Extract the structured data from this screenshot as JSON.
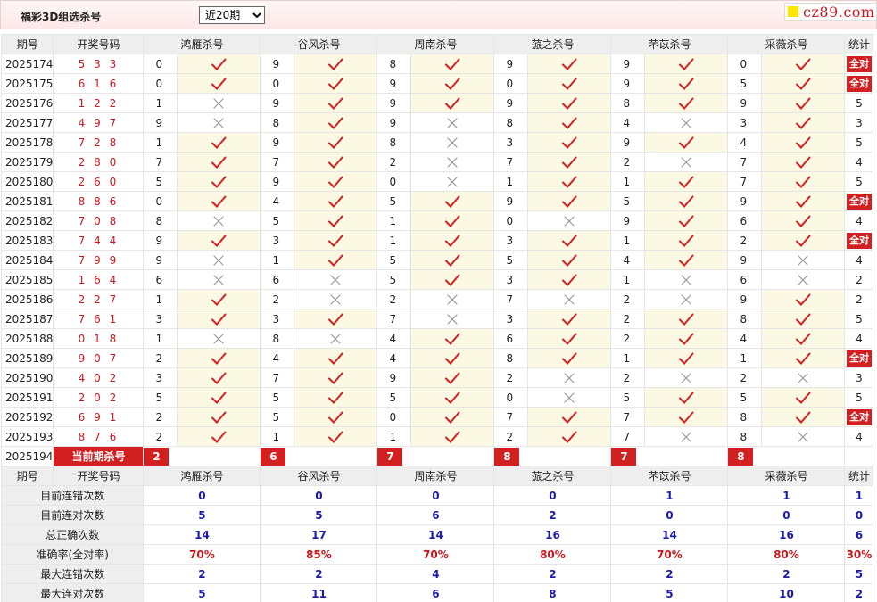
{
  "header": {
    "title": "福彩3D组选杀号",
    "period_select": {
      "value": "近20期",
      "options": [
        "近20期"
      ]
    },
    "logo_text": "cz89.com"
  },
  "columns": {
    "period": "期号",
    "numbers": "开奖号码",
    "experts": [
      "鸿雁杀号",
      "谷风杀号",
      "周南杀号",
      "蒎之杀号",
      "芣苡杀号",
      "采薇杀号"
    ],
    "stats": "统计"
  },
  "rows": [
    {
      "period": "2025174",
      "numbers": "5 3 3",
      "kills": [
        {
          "n": "0",
          "ok": true
        },
        {
          "n": "9",
          "ok": true
        },
        {
          "n": "8",
          "ok": true
        },
        {
          "n": "9",
          "ok": true
        },
        {
          "n": "9",
          "ok": true
        },
        {
          "n": "0",
          "ok": true
        }
      ],
      "stat": "全对"
    },
    {
      "period": "2025175",
      "numbers": "6 1 6",
      "kills": [
        {
          "n": "0",
          "ok": true
        },
        {
          "n": "0",
          "ok": true
        },
        {
          "n": "9",
          "ok": true
        },
        {
          "n": "0",
          "ok": true
        },
        {
          "n": "9",
          "ok": true
        },
        {
          "n": "5",
          "ok": true
        }
      ],
      "stat": "全对"
    },
    {
      "period": "2025176",
      "numbers": "1 2 2",
      "kills": [
        {
          "n": "1",
          "ok": false
        },
        {
          "n": "9",
          "ok": true
        },
        {
          "n": "9",
          "ok": true
        },
        {
          "n": "9",
          "ok": true
        },
        {
          "n": "8",
          "ok": true
        },
        {
          "n": "9",
          "ok": true
        }
      ],
      "stat": "5"
    },
    {
      "period": "2025177",
      "numbers": "4 9 7",
      "kills": [
        {
          "n": "9",
          "ok": false
        },
        {
          "n": "8",
          "ok": true
        },
        {
          "n": "9",
          "ok": false
        },
        {
          "n": "8",
          "ok": true
        },
        {
          "n": "4",
          "ok": false
        },
        {
          "n": "3",
          "ok": true
        }
      ],
      "stat": "3"
    },
    {
      "period": "2025178",
      "numbers": "7 2 8",
      "kills": [
        {
          "n": "1",
          "ok": true
        },
        {
          "n": "9",
          "ok": true
        },
        {
          "n": "8",
          "ok": false
        },
        {
          "n": "3",
          "ok": true
        },
        {
          "n": "9",
          "ok": true
        },
        {
          "n": "4",
          "ok": true
        }
      ],
      "stat": "5"
    },
    {
      "period": "2025179",
      "numbers": "2 8 0",
      "kills": [
        {
          "n": "7",
          "ok": true
        },
        {
          "n": "7",
          "ok": true
        },
        {
          "n": "2",
          "ok": false
        },
        {
          "n": "7",
          "ok": true
        },
        {
          "n": "2",
          "ok": false
        },
        {
          "n": "7",
          "ok": true
        }
      ],
      "stat": "4"
    },
    {
      "period": "2025180",
      "numbers": "2 6 0",
      "kills": [
        {
          "n": "5",
          "ok": true
        },
        {
          "n": "9",
          "ok": true
        },
        {
          "n": "0",
          "ok": false
        },
        {
          "n": "1",
          "ok": true
        },
        {
          "n": "1",
          "ok": true
        },
        {
          "n": "7",
          "ok": true
        }
      ],
      "stat": "5"
    },
    {
      "period": "2025181",
      "numbers": "8 8 6",
      "kills": [
        {
          "n": "0",
          "ok": true
        },
        {
          "n": "4",
          "ok": true
        },
        {
          "n": "5",
          "ok": true
        },
        {
          "n": "9",
          "ok": true
        },
        {
          "n": "5",
          "ok": true
        },
        {
          "n": "9",
          "ok": true
        }
      ],
      "stat": "全对"
    },
    {
      "period": "2025182",
      "numbers": "7 0 8",
      "kills": [
        {
          "n": "8",
          "ok": false
        },
        {
          "n": "5",
          "ok": true
        },
        {
          "n": "1",
          "ok": true
        },
        {
          "n": "0",
          "ok": false
        },
        {
          "n": "9",
          "ok": true
        },
        {
          "n": "6",
          "ok": true
        }
      ],
      "stat": "4"
    },
    {
      "period": "2025183",
      "numbers": "7 4 4",
      "kills": [
        {
          "n": "9",
          "ok": true
        },
        {
          "n": "3",
          "ok": true
        },
        {
          "n": "1",
          "ok": true
        },
        {
          "n": "3",
          "ok": true
        },
        {
          "n": "1",
          "ok": true
        },
        {
          "n": "2",
          "ok": true
        }
      ],
      "stat": "全对"
    },
    {
      "period": "2025184",
      "numbers": "7 9 9",
      "kills": [
        {
          "n": "9",
          "ok": false
        },
        {
          "n": "1",
          "ok": true
        },
        {
          "n": "5",
          "ok": true
        },
        {
          "n": "5",
          "ok": true
        },
        {
          "n": "4",
          "ok": true
        },
        {
          "n": "9",
          "ok": false
        }
      ],
      "stat": "4"
    },
    {
      "period": "2025185",
      "numbers": "1 6 4",
      "kills": [
        {
          "n": "6",
          "ok": false
        },
        {
          "n": "6",
          "ok": false
        },
        {
          "n": "5",
          "ok": true
        },
        {
          "n": "3",
          "ok": true
        },
        {
          "n": "1",
          "ok": false
        },
        {
          "n": "6",
          "ok": false
        }
      ],
      "stat": "2"
    },
    {
      "period": "2025186",
      "numbers": "2 2 7",
      "kills": [
        {
          "n": "1",
          "ok": true
        },
        {
          "n": "2",
          "ok": false
        },
        {
          "n": "2",
          "ok": false
        },
        {
          "n": "7",
          "ok": false
        },
        {
          "n": "2",
          "ok": false
        },
        {
          "n": "9",
          "ok": true
        }
      ],
      "stat": "2"
    },
    {
      "period": "2025187",
      "numbers": "7 6 1",
      "kills": [
        {
          "n": "3",
          "ok": true
        },
        {
          "n": "3",
          "ok": true
        },
        {
          "n": "7",
          "ok": false
        },
        {
          "n": "3",
          "ok": true
        },
        {
          "n": "2",
          "ok": true
        },
        {
          "n": "8",
          "ok": true
        }
      ],
      "stat": "5"
    },
    {
      "period": "2025188",
      "numbers": "0 1 8",
      "kills": [
        {
          "n": "1",
          "ok": false
        },
        {
          "n": "8",
          "ok": false
        },
        {
          "n": "4",
          "ok": true
        },
        {
          "n": "6",
          "ok": true
        },
        {
          "n": "2",
          "ok": true
        },
        {
          "n": "4",
          "ok": true
        }
      ],
      "stat": "4"
    },
    {
      "period": "2025189",
      "numbers": "9 0 7",
      "kills": [
        {
          "n": "2",
          "ok": true
        },
        {
          "n": "4",
          "ok": true
        },
        {
          "n": "4",
          "ok": true
        },
        {
          "n": "8",
          "ok": true
        },
        {
          "n": "1",
          "ok": true
        },
        {
          "n": "1",
          "ok": true
        }
      ],
      "stat": "全对"
    },
    {
      "period": "2025190",
      "numbers": "4 0 2",
      "kills": [
        {
          "n": "3",
          "ok": true
        },
        {
          "n": "7",
          "ok": true
        },
        {
          "n": "9",
          "ok": true
        },
        {
          "n": "2",
          "ok": false
        },
        {
          "n": "2",
          "ok": false
        },
        {
          "n": "2",
          "ok": false
        }
      ],
      "stat": "3"
    },
    {
      "period": "2025191",
      "numbers": "2 0 2",
      "kills": [
        {
          "n": "5",
          "ok": true
        },
        {
          "n": "5",
          "ok": true
        },
        {
          "n": "5",
          "ok": true
        },
        {
          "n": "0",
          "ok": false
        },
        {
          "n": "5",
          "ok": true
        },
        {
          "n": "5",
          "ok": true
        }
      ],
      "stat": "5"
    },
    {
      "period": "2025192",
      "numbers": "6 9 1",
      "kills": [
        {
          "n": "2",
          "ok": true
        },
        {
          "n": "5",
          "ok": true
        },
        {
          "n": "0",
          "ok": true
        },
        {
          "n": "7",
          "ok": true
        },
        {
          "n": "7",
          "ok": true
        },
        {
          "n": "8",
          "ok": true
        }
      ],
      "stat": "全对"
    },
    {
      "period": "2025193",
      "numbers": "8 7 6",
      "kills": [
        {
          "n": "2",
          "ok": true
        },
        {
          "n": "1",
          "ok": true
        },
        {
          "n": "1",
          "ok": true
        },
        {
          "n": "2",
          "ok": true
        },
        {
          "n": "7",
          "ok": false
        },
        {
          "n": "8",
          "ok": false
        }
      ],
      "stat": "4"
    }
  ],
  "current": {
    "period": "2025194",
    "label": "当前期杀号",
    "kills": [
      "2",
      "6",
      "7",
      "8",
      "7",
      "8"
    ]
  },
  "summary": [
    {
      "label": "目前连错次数",
      "values": [
        "0",
        "0",
        "0",
        "0",
        "1",
        "1"
      ],
      "stat": "1",
      "red": false
    },
    {
      "label": "目前连对次数",
      "values": [
        "5",
        "5",
        "6",
        "2",
        "0",
        "0"
      ],
      "stat": "0",
      "red": false
    },
    {
      "label": "总正确次数",
      "values": [
        "14",
        "17",
        "14",
        "16",
        "14",
        "16"
      ],
      "stat": "6",
      "red": false
    },
    {
      "label": "准确率(全对率)",
      "values": [
        "70%",
        "85%",
        "70%",
        "80%",
        "70%",
        "80%"
      ],
      "stat": "30%",
      "red": true
    },
    {
      "label": "最大连错次数",
      "values": [
        "2",
        "2",
        "4",
        "2",
        "2",
        "2"
      ],
      "stat": "5",
      "red": false
    },
    {
      "label": "最大连对次数",
      "values": [
        "5",
        "11",
        "6",
        "8",
        "5",
        "10"
      ],
      "stat": "2",
      "red": false
    }
  ],
  "icons": {
    "hit": "check-icon",
    "miss": "cross-icon"
  },
  "colors": {
    "accent_red": "#d22020",
    "number_red": "#c8191f",
    "summary_blue": "#1a1aa8",
    "hit_bg": "#fbf8e3",
    "header_bg": "#eeeeee"
  }
}
